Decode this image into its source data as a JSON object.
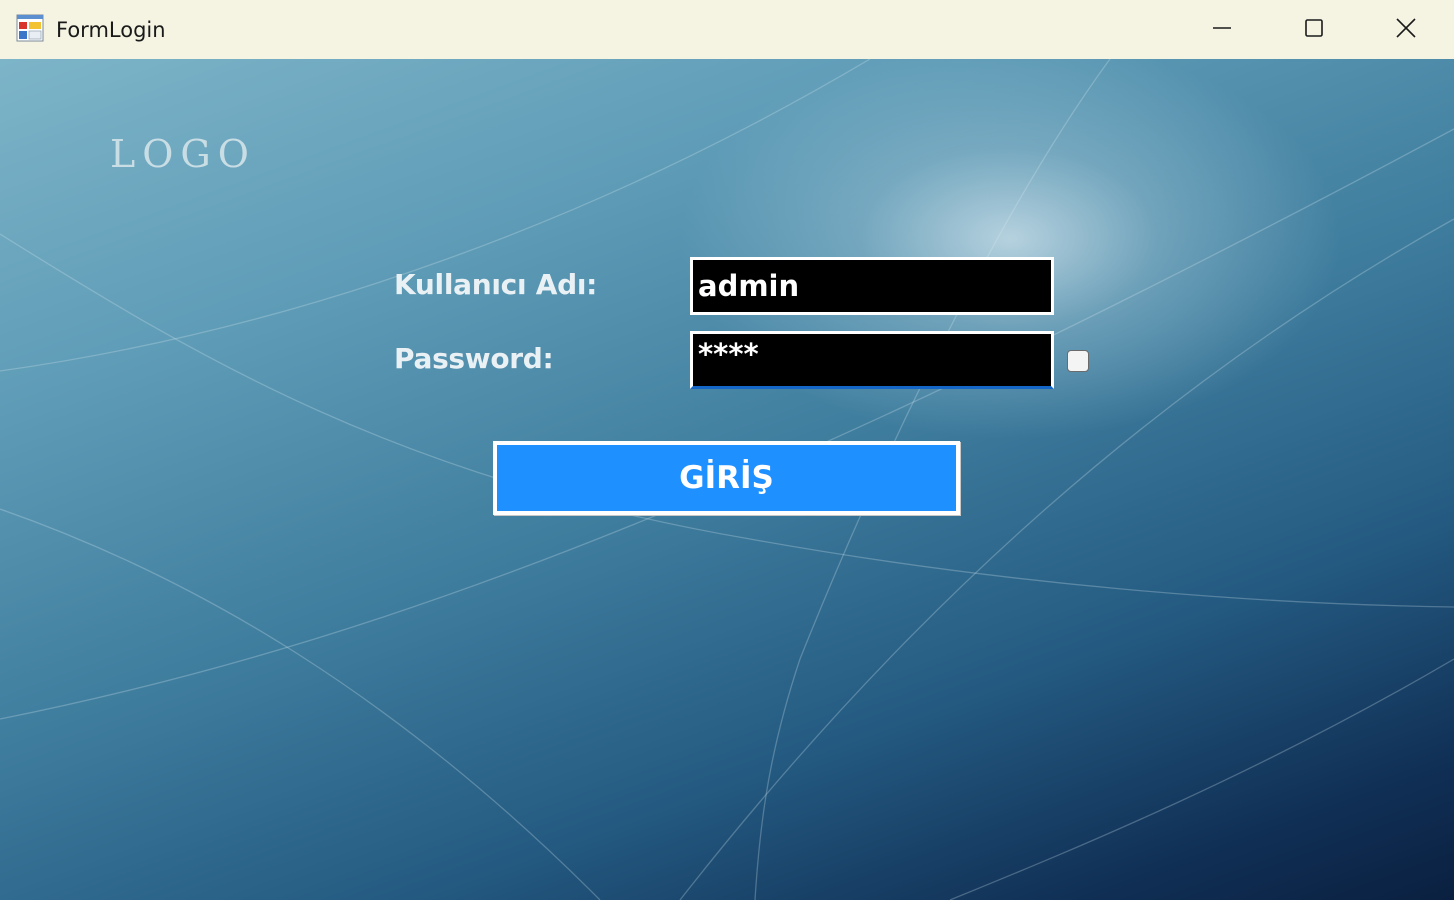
{
  "window": {
    "title": "FormLogin",
    "app_icon": "winforms-app-icon",
    "controls": {
      "minimize_icon": "minimize-icon",
      "maximize_icon": "maximize-icon",
      "close_icon": "close-icon"
    }
  },
  "form": {
    "logo_text": "LOGO",
    "username_label": "Kullanıcı Adı:",
    "username_value": "admin",
    "password_label": "Password:",
    "password_value_masked": "****",
    "show_password_checked": false,
    "login_button_label": "GİRİŞ"
  },
  "colors": {
    "titlebar_bg": "#f5f3e1",
    "field_bg": "#000000",
    "field_text": "#ffffff",
    "button_bg": "#1e90ff",
    "label_text": "#eaf1f4",
    "focus_underline": "#1467c7"
  }
}
